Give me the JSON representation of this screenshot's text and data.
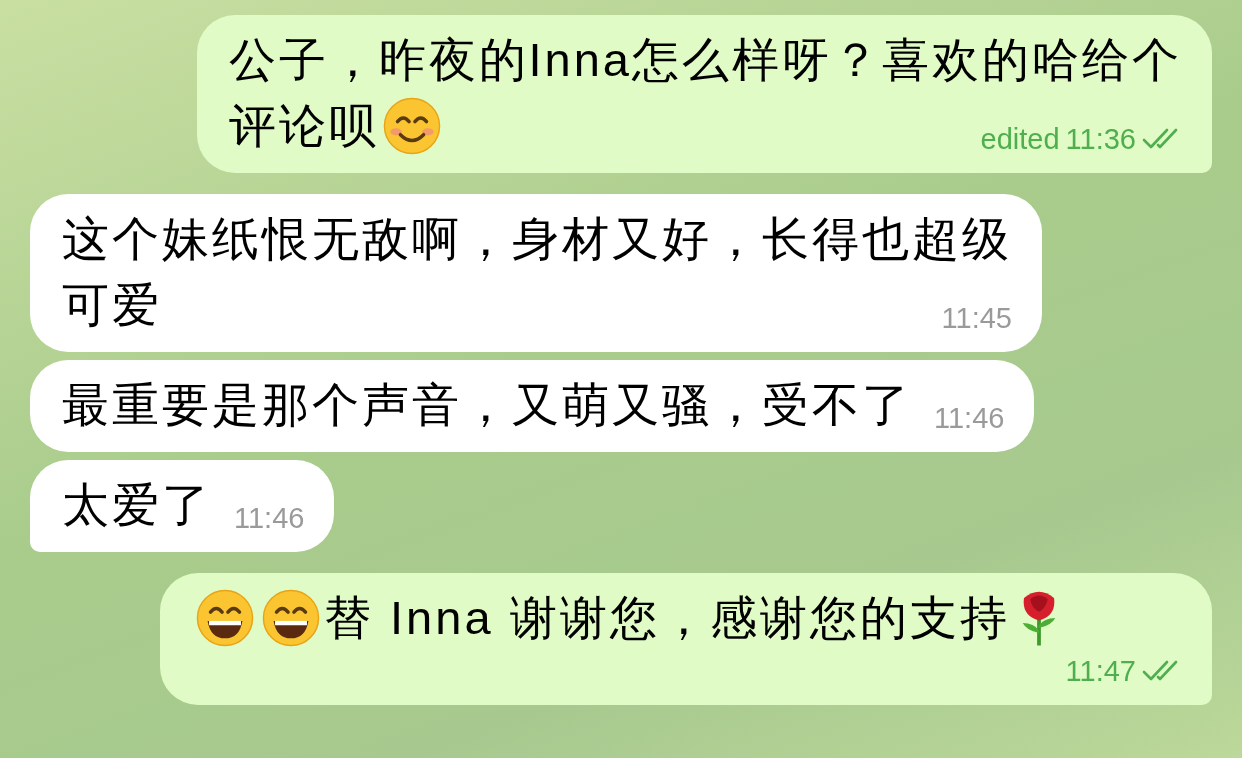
{
  "messages": [
    {
      "kind": "outgoing",
      "lines": [
        [
          {
            "kind": "text",
            "text": "公子，昨夜的Inna怎么样呀？喜欢的哈给个"
          }
        ],
        [
          {
            "kind": "text",
            "text": "评论呗"
          },
          {
            "kind": "smile"
          }
        ]
      ],
      "edited_label": "edited",
      "time": "11:36",
      "read": true,
      "tail": true
    },
    {
      "kind": "incoming",
      "lines": [
        [
          {
            "kind": "text",
            "text": "这个妹纸恨无敌啊，身材又好，长得也超级"
          }
        ],
        [
          {
            "kind": "text",
            "text": "可爱"
          }
        ]
      ],
      "time": "11:45",
      "tail": false
    },
    {
      "kind": "incoming",
      "lines": [
        [
          {
            "kind": "text",
            "text": "最重要是那个声音，又萌又骚，受不了"
          }
        ]
      ],
      "time": "11:46",
      "tail": false
    },
    {
      "kind": "incoming",
      "lines": [
        [
          {
            "kind": "text",
            "text": "太爱了"
          }
        ]
      ],
      "time": "11:46",
      "tail": true
    },
    {
      "kind": "outgoing",
      "lines": [
        [
          {
            "kind": "grin"
          },
          {
            "kind": "grin"
          },
          {
            "kind": "text",
            "text": "替 Inna 谢谢您，感谢您的支持"
          },
          {
            "kind": "rose"
          }
        ]
      ],
      "time": "11:47",
      "read": true,
      "tail": true
    }
  ]
}
